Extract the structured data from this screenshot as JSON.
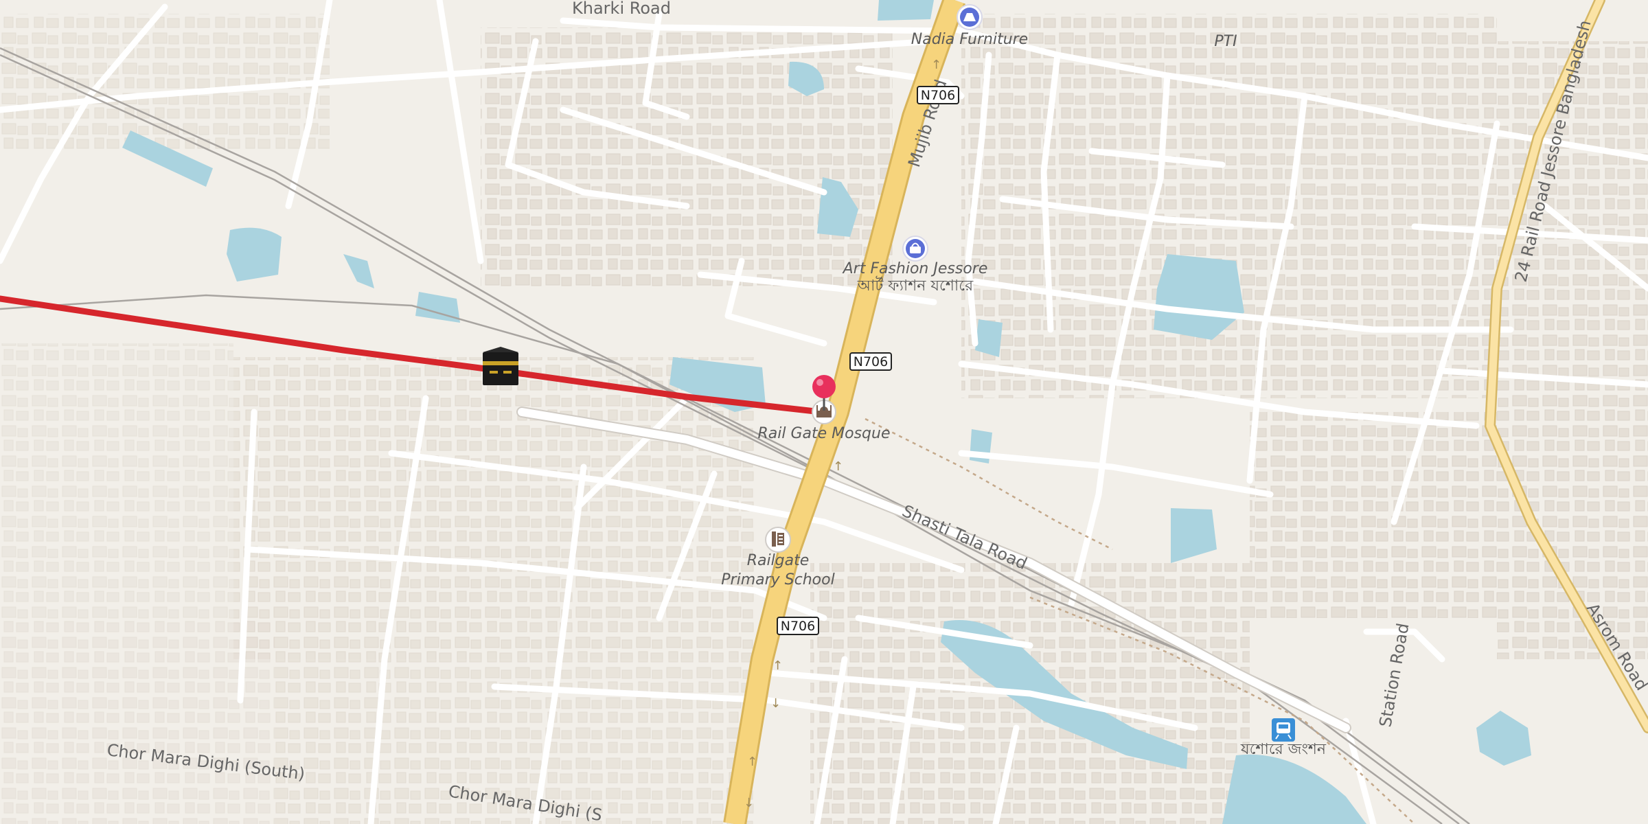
{
  "map": {
    "roads": {
      "kharki": "Kharki Road",
      "mujib": "Mujib Road",
      "shasti_tala": "Shasti Tala Road",
      "station": "Station Road",
      "rail_road": "24 Rail Road Jessore Bangladesh",
      "asrom": "Asrom Road",
      "chor_mara_south": "Chor Mara Dighi (South)",
      "chor_mara_2": "Chor Mara Dighi (S"
    },
    "shields": [
      "N706",
      "N706",
      "N706"
    ],
    "pois": {
      "nadia": "Nadia Furniture",
      "pti": "PTI",
      "art_fashion": "Art Fashion Jessore",
      "art_fashion_bn": "আর্ট ফ্যাশন যশোরে",
      "rail_gate_mosque": "Rail Gate Mosque",
      "railgate_school_1": "Railgate",
      "railgate_school_2": "Primary School",
      "station_bn": "যশোরে জংশন"
    },
    "icons": {
      "kaaba": "kaaba-icon",
      "pin": "location-pin-icon",
      "mosque": "mosque-icon",
      "school": "school-icon",
      "train": "train-station-icon",
      "shop": "shop-icon",
      "furniture": "furniture-icon"
    },
    "colors": {
      "background": "#f2efe9",
      "water": "#aad3df",
      "building": "#e4ddd4",
      "trunk_road": "#f6d47c",
      "route_line": "#d6262c",
      "pin": "#e8305c",
      "poi_blue": "#5b6fd6"
    }
  }
}
